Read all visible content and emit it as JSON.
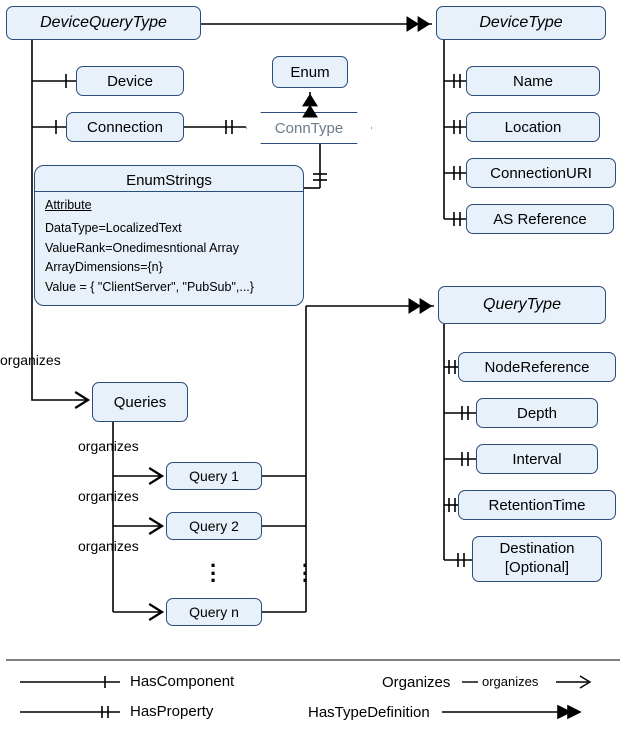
{
  "types": {
    "deviceQueryType": "DeviceQueryType",
    "deviceType": "DeviceType",
    "queryType": "QueryType"
  },
  "deviceQuery": {
    "device": "Device",
    "connection": "Connection",
    "queries": "Queries",
    "queryItems": [
      "Query 1",
      "Query 2",
      "Query n"
    ]
  },
  "deviceProps": {
    "name": "Name",
    "location": "Location",
    "connectionUri": "ConnectionURI",
    "asReference": "AS Reference"
  },
  "queryProps": {
    "nodeRef": "NodeReference",
    "depth": "Depth",
    "interval": "Interval",
    "retention": "RetentionTime",
    "destination": "Destination\n[Optional]"
  },
  "connType": {
    "label": "ConnType",
    "enum": "Enum"
  },
  "enumStrings": {
    "title": "EnumStrings",
    "attrLabel": "Attribute",
    "line1": "DataType=LocalizedText",
    "line2": "ValueRank=Onedimesntional Array",
    "line3": "ArrayDimensions={n}",
    "line4": "Value = { \"ClientServer\", \"PubSub\",...}"
  },
  "edgeLabels": {
    "organizes": "organizes"
  },
  "legend": {
    "hasComponent": "HasComponent",
    "hasProperty": "HasProperty",
    "organizes": "Organizes",
    "hasTypeDef": "HasTypeDefinition"
  }
}
